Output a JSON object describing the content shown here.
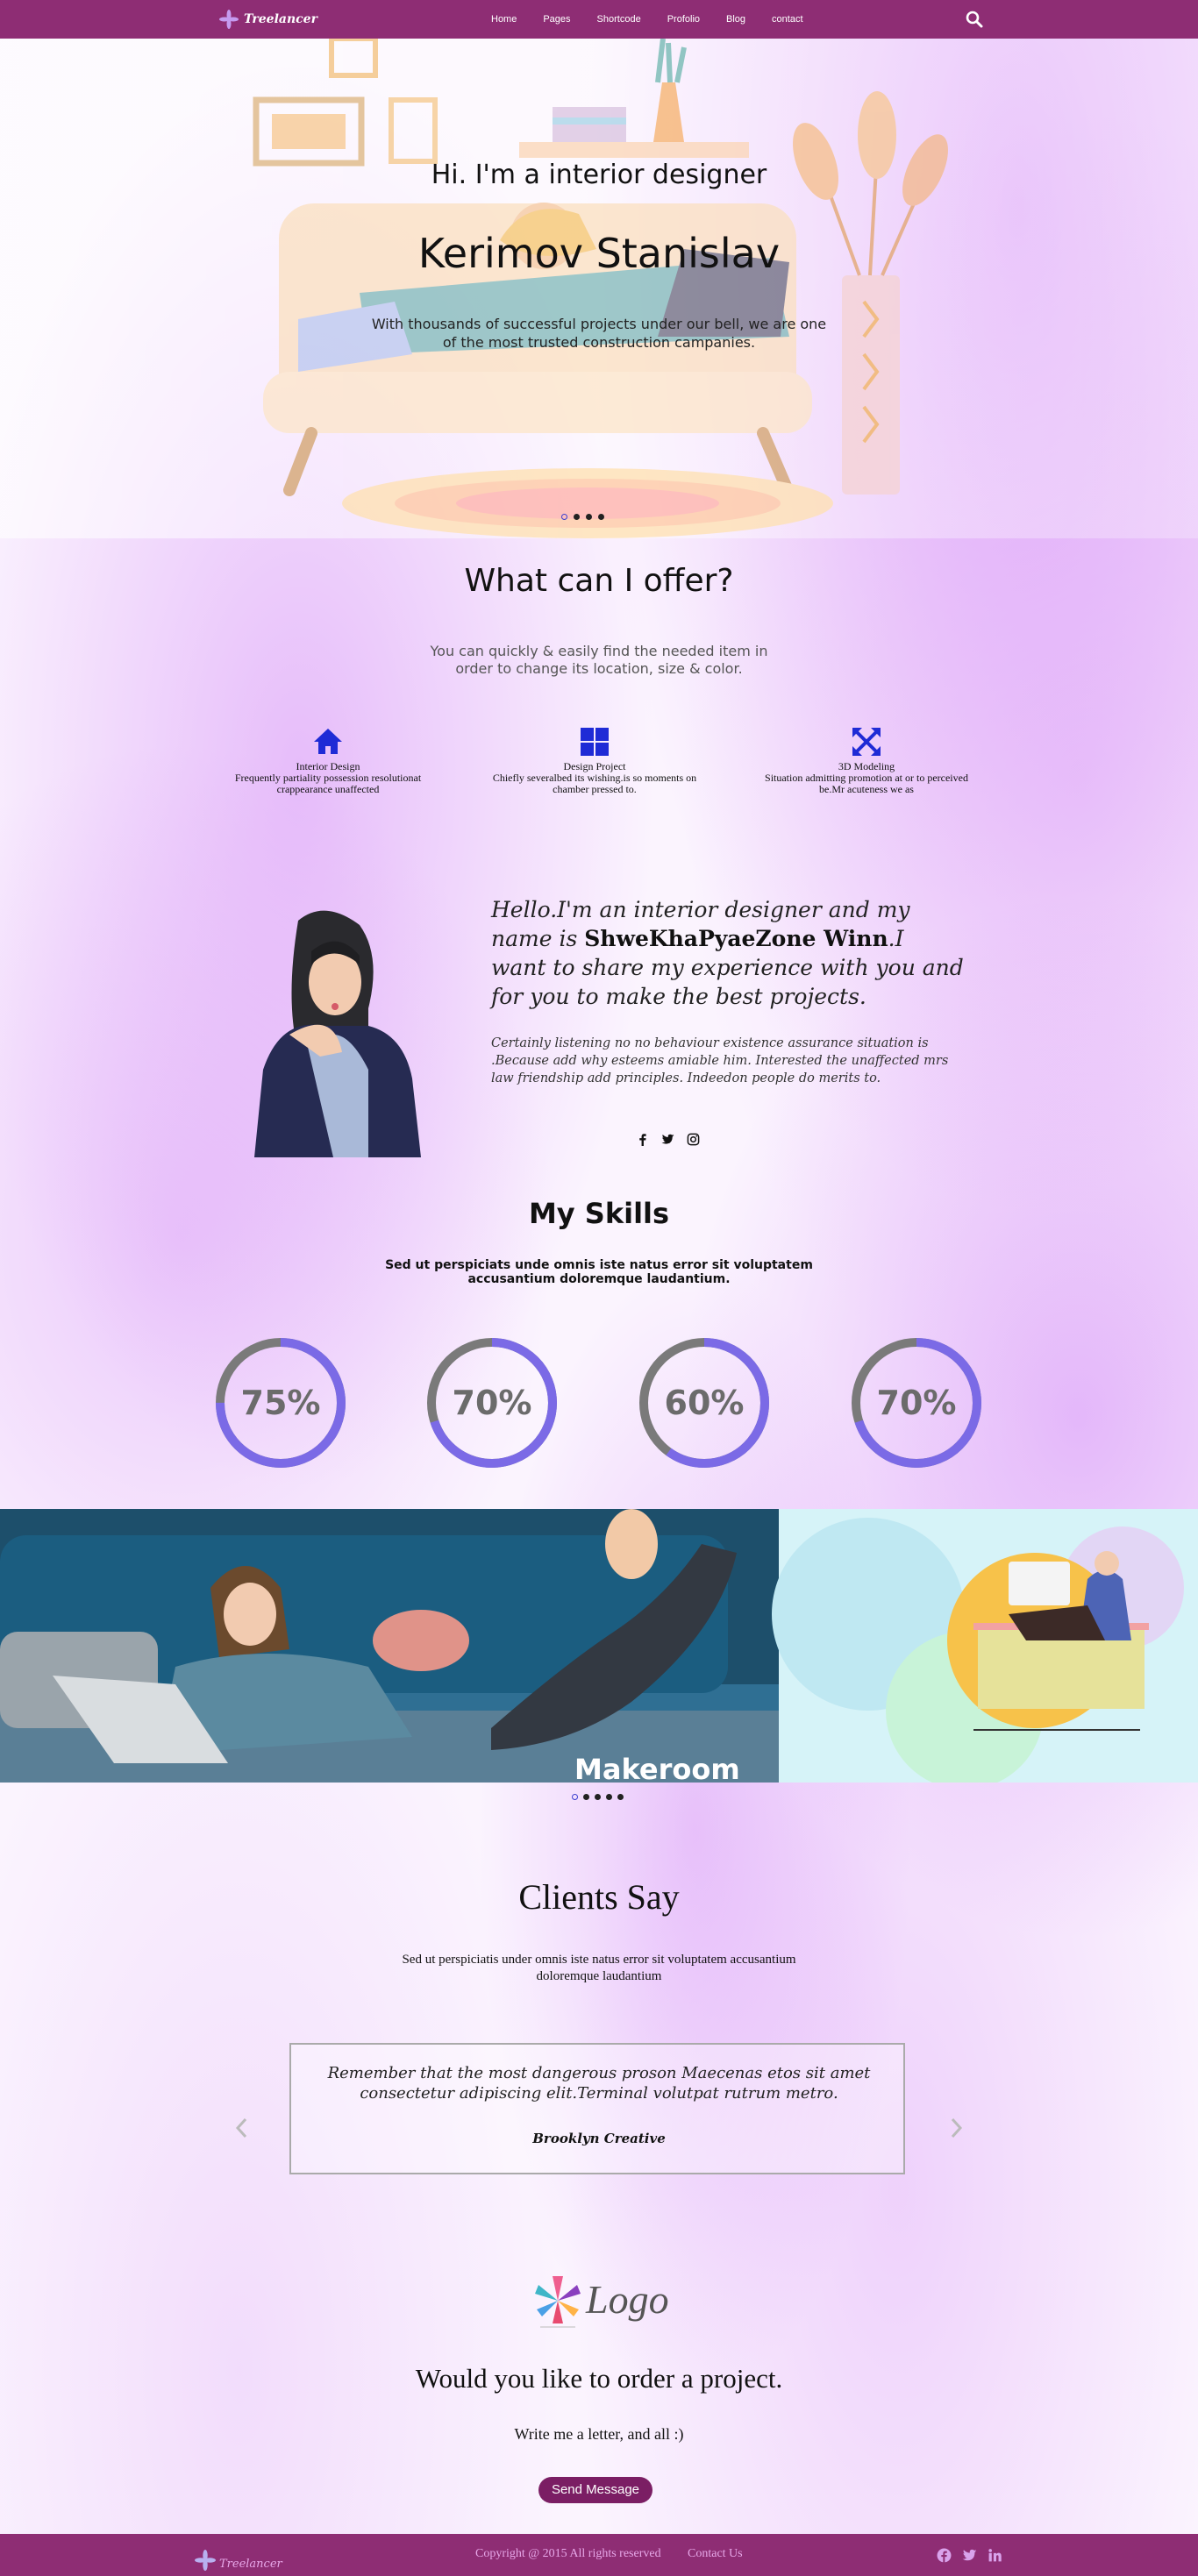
{
  "header": {
    "brand": "Treelancer",
    "nav": [
      "Home",
      "Pages",
      "Shortcode",
      "Profolio",
      "Blog",
      "contact"
    ]
  },
  "hero": {
    "intro": "Hi. I'm a interior designer",
    "name": "Kerimov Stanislav",
    "description": "With thousands of successful projects under our bell, we are one of the most trusted construction campanies."
  },
  "offer": {
    "title": "What can I offer?",
    "subtitle": "You can quickly & easily find the needed item in order to change its location, size & color.",
    "services": [
      {
        "icon": "home-icon",
        "title": "Interior Design",
        "text": "Frequently partiality possession resolutionat crappearance unaffected"
      },
      {
        "icon": "grid-icon",
        "title": "Design Project",
        "text": "Chiefly severalbed its wishing.is so moments on chamber pressed to."
      },
      {
        "icon": "expand-icon",
        "title": "3D Modeling",
        "text": "Situation admitting promotion at or to perceived be.Mr acuteness we as"
      }
    ]
  },
  "about": {
    "lead": "Hello.I'm an interior designer and my name is ",
    "name": "ShweKhaPyaeZone Winn",
    "rest": ".I want to share my experience with you and for you to make the best projects.",
    "body": "Certainly listening no no behaviour existence assurance situation is .Because add why esteems amiable him. Interested the unaffected mrs law friendship add principles. Indeedon people do merits to."
  },
  "skills": {
    "title": "My Skills",
    "subtitle": "Sed ut perspiciats unde omnis iste natus error sit voluptatem accusantium doloremque laudantium.",
    "items": [
      {
        "label": "75%",
        "value": 0.75
      },
      {
        "label": "70%",
        "value": 0.7
      },
      {
        "label": "60%",
        "value": 0.6
      },
      {
        "label": "70%",
        "value": 0.7
      }
    ]
  },
  "gallery": {
    "caption": "Makeroom"
  },
  "clients": {
    "title": "Clients Say",
    "subtitle": "Sed ut perspiciatis under omnis iste natus error sit voluptatem accusantium doloremque laudantium",
    "quote": "Remember that the most dangerous proson Maecenas etos sit amet consectetur adipiscing elit.Terminal volutpat rutrum metro.",
    "author": "Brooklyn Creative"
  },
  "cta": {
    "logo_text": "Logo",
    "title": "Would you like to order a project.",
    "subtitle": "Write me a letter, and all :)",
    "button": "Send Message"
  },
  "footer": {
    "brand": "Treelancer",
    "copyright": "Copyright @ 2015 All rights reserved",
    "contact": "Contact Us"
  },
  "colors": {
    "bar": "#8e2d74",
    "accent": "#7b6ae6",
    "button": "#7b1e64",
    "icon_blue": "#1f2bd6"
  }
}
